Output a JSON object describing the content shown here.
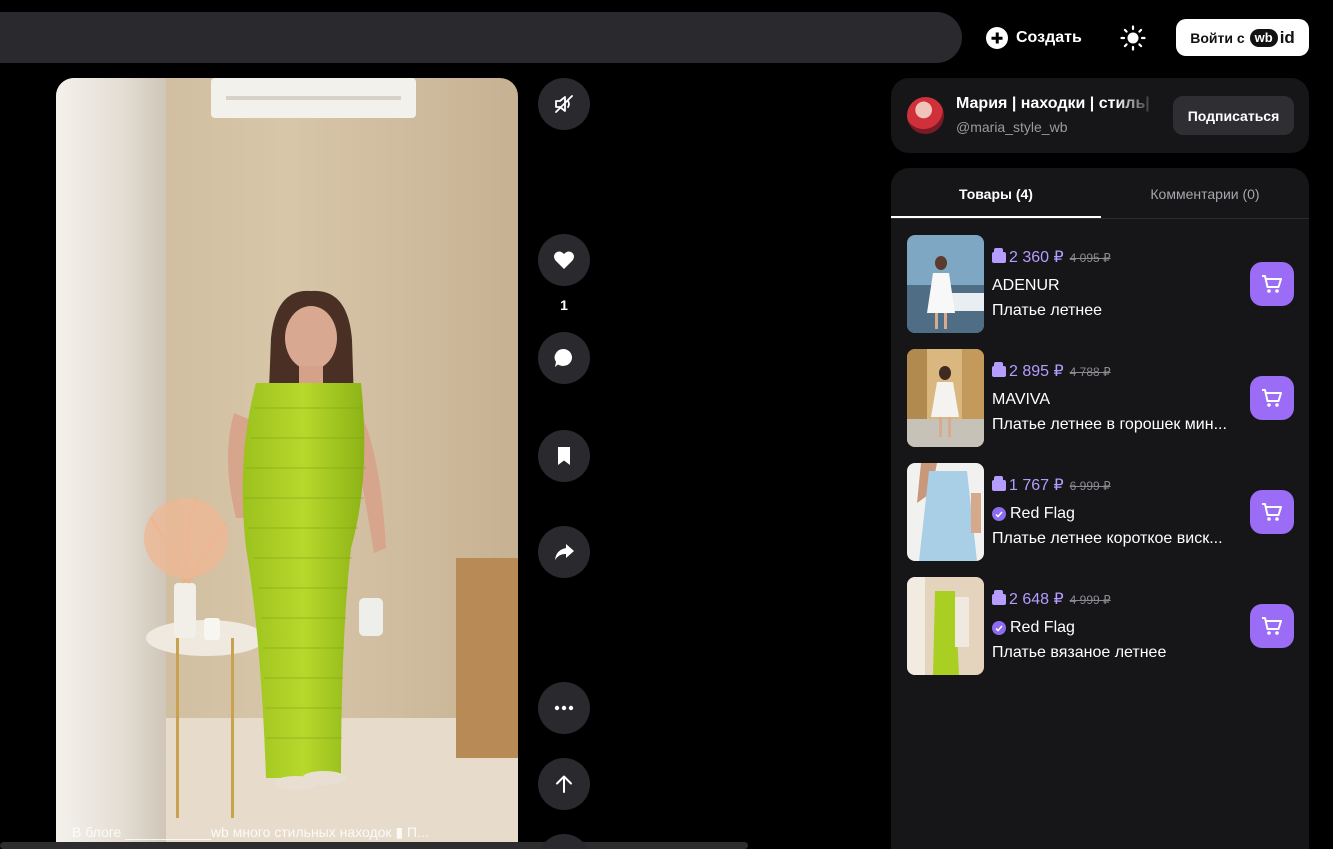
{
  "header": {
    "create_label": "Создать",
    "login_label": "Войти с",
    "wbid_wb": "wb",
    "wbid_id": "id"
  },
  "video": {
    "caption": "В блоге ___________wb много стильных находок ▮ П...",
    "like_count": "1"
  },
  "icons": {
    "mute": "muted-speaker-icon",
    "like": "heart-icon",
    "comment": "comment-bubble-icon",
    "save": "bookmark-icon",
    "share": "share-arrow-icon",
    "more": "more-dots-icon",
    "up": "arrow-up-icon",
    "theme": "sun-icon",
    "cart": "cart-icon"
  },
  "author": {
    "name": "Мария | находки | стиль| У",
    "handle": "@maria_style_wb",
    "subscribe_label": "Подписаться"
  },
  "tabs": {
    "products": "Товары (4)",
    "comments": "Комментарии (0)"
  },
  "colors": {
    "accent": "#9b6cf5",
    "price": "#b59cff",
    "panel": "#161618"
  },
  "products": [
    {
      "price": "2 360 ₽",
      "old_price": "4 095 ₽",
      "brand": "ADENUR",
      "verified": false,
      "name": "Платье летнее"
    },
    {
      "price": "2 895 ₽",
      "old_price": "4 788 ₽",
      "brand": "MAVIVA",
      "verified": false,
      "name": "Платье летнее в горошек мин..."
    },
    {
      "price": "1 767 ₽",
      "old_price": "6 999 ₽",
      "brand": "Red Flag",
      "verified": true,
      "name": "Платье летнее короткое виск..."
    },
    {
      "price": "2 648 ₽",
      "old_price": "4 999 ₽",
      "brand": "Red Flag",
      "verified": true,
      "name": "Платье вязаное летнее"
    }
  ]
}
